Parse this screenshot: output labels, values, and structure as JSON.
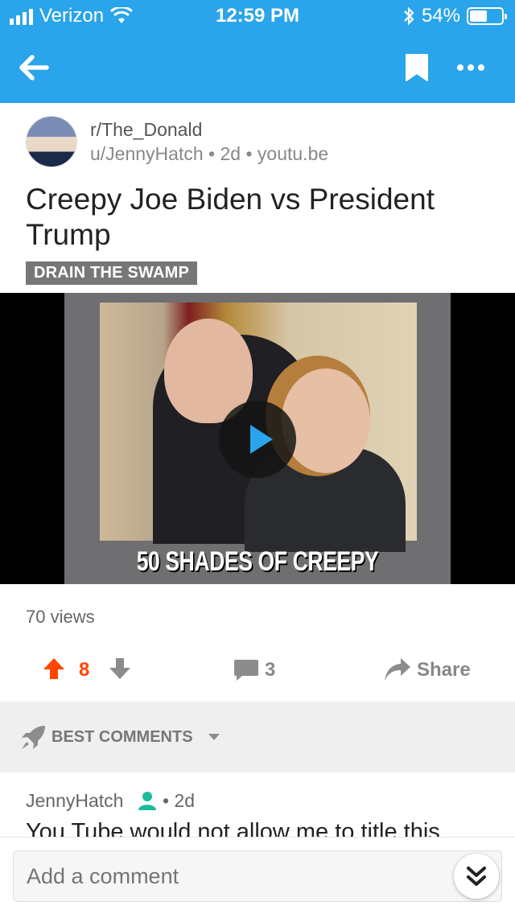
{
  "status_bar": {
    "carrier": "Verizon",
    "time": "12:59 PM",
    "battery": "54%",
    "battery_level": 0.54,
    "signal_bars": 4
  },
  "nav": {
    "back_icon": "arrow-left-icon",
    "bookmark_icon": "bookmark-icon",
    "more_icon": "ellipsis-icon"
  },
  "post": {
    "subreddit": "r/The_Donald",
    "author": "u/JennyHatch",
    "age": "2d",
    "domain": "youtu.be",
    "separator": "•",
    "title": "Creepy Joe Biden vs President Trump",
    "flair": "DRAIN THE SWAMP",
    "video_caption": "50 SHADES OF CREEPY",
    "views": "70 views",
    "score": "8",
    "comments": "3",
    "share_label": "Share"
  },
  "comments_section": {
    "sort_label": "BEST COMMENTS",
    "first_comment": {
      "author": "JennyHatch",
      "age": "2d",
      "body": "You Tube would not allow me to title this"
    }
  },
  "composer": {
    "placeholder": "Add a comment"
  },
  "colors": {
    "accent": "#2aa4ea",
    "upvote": "#ff4500",
    "flair_bg": "#777777",
    "op_icon": "#1abc9c"
  }
}
